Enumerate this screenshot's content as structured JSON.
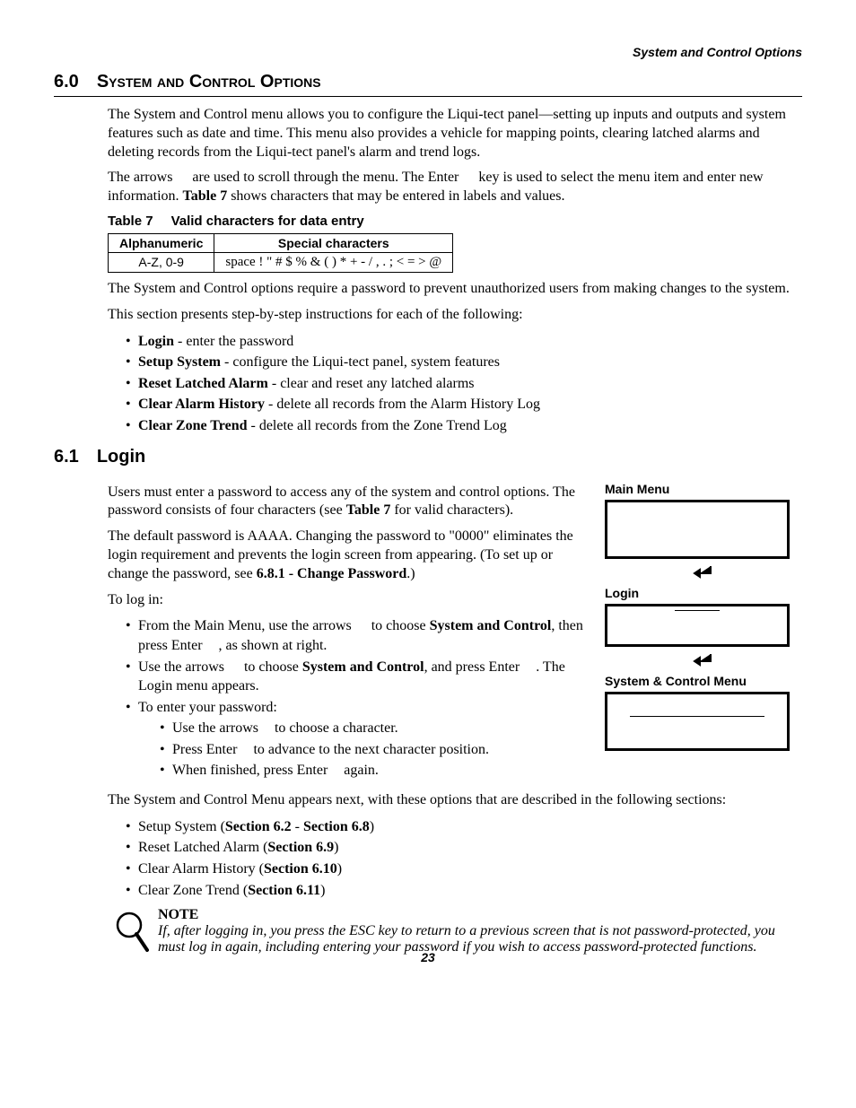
{
  "running_head": "System and Control Options",
  "h60": {
    "num": "6.0",
    "title": "System and Control Options"
  },
  "p60_1": "The System and Control menu allows you to configure the Liqui-tect panel—setting up inputs and outputs and system features such as date and time. This menu also provides a vehicle for mapping points, clearing latched alarms and deleting records from the Liqui-tect panel's alarm and trend logs.",
  "p60_2a": "The arrows",
  "p60_2b": "are used to scroll through the menu. The Enter",
  "p60_2c": "key is used to select the menu item and enter new information.",
  "p60_2d": "Table 7",
  "p60_2e": "shows characters that may be entered in labels and values.",
  "table7": {
    "caption_num": "Table 7",
    "caption_text": "Valid characters for data entry",
    "head_l": "Alphanumeric",
    "head_r": "Special characters",
    "cell_l": "A-Z, 0-9",
    "cell_r": "space ! \" # $ % & ( ) * + - / , . ; < = > @"
  },
  "p60_3": "The System and Control options require a password to prevent unauthorized users from making changes to the system.",
  "p60_4": "This section presents step-by-step instructions for each of the following:",
  "list60": [
    {
      "b": "Login",
      "t": " - enter the password"
    },
    {
      "b": "Setup System",
      "t": " - configure the Liqui-tect panel, system features"
    },
    {
      "b": "Reset Latched Alarm",
      "t": " - clear and reset any latched alarms"
    },
    {
      "b": "Clear Alarm History",
      "t": " - delete all records from the Alarm History Log"
    },
    {
      "b": "Clear Zone Trend",
      "t": " - delete all records from the Zone Trend Log"
    }
  ],
  "h61": {
    "num": "6.1",
    "title": "Login"
  },
  "p61_1a": "Users must enter a password to access any of the system and control options. The password consists of four characters (see ",
  "p61_1b": "Table 7",
  "p61_1c": " for valid characters).",
  "p61_2a": "The default password is AAAA. Changing the password to \"0000\" eliminates the login requirement and prevents the login screen from appearing. (To set up or change the password, see ",
  "p61_2b": "6.8.1 - Change Password",
  "p61_2c": ".)",
  "p61_3": "To log in:",
  "list61": {
    "i1a": "From the Main Menu, use the arrows",
    "i1b": "to choose ",
    "i1c": "System and Control",
    "i1d": ", then press Enter",
    "i1e": ", as shown at right.",
    "i2a": "Use the arrows",
    "i2b": "to choose ",
    "i2c": "System and Control",
    "i2d": ", and press Enter",
    "i2e": ". The Login menu appears.",
    "i3": "To enter your password:",
    "i3s1a": "Use the arrows",
    "i3s1b": "to choose a character.",
    "i3s2a": "Press Enter",
    "i3s2b": "to advance to the next character position.",
    "i3s3a": "When finished, press Enter",
    "i3s3b": "again."
  },
  "p61_4": "The System and Control Menu appears next, with these options that are described in the following sections:",
  "list61b": [
    {
      "pre": "Setup System (",
      "b": "Section 6.2",
      "mid": " - ",
      "b2": "Section 6.8",
      "post": ")"
    },
    {
      "pre": "Reset Latched Alarm (",
      "b": "Section 6.9",
      "post": ")"
    },
    {
      "pre": "Clear Alarm History (",
      "b": "Section 6.10",
      "post": ")"
    },
    {
      "pre": "Clear Zone Trend (",
      "b": "Section 6.11",
      "post": ")"
    }
  ],
  "note": {
    "label": "NOTE",
    "text": "If, after logging in, you press the ESC key to return to a previous screen that is not password-protected, you must log in again, including entering your password if you wish to access password-protected functions."
  },
  "side": {
    "main_menu": "Main Menu",
    "login": "Login",
    "sys_ctrl": "System & Control Menu"
  },
  "page_no": "23"
}
